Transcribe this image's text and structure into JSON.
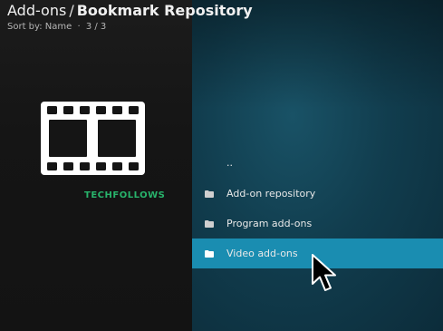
{
  "header": {
    "breadcrumb_parent": "Add-ons",
    "separator": "/",
    "breadcrumb_current": "Bookmark Repository",
    "sort_label": "Sort by: Name",
    "dot": "·",
    "page_count": "3 / 3"
  },
  "watermark": "TECHFOLLOWS",
  "list": {
    "items": [
      {
        "label": "..",
        "icon": "none"
      },
      {
        "label": "Add-on repository",
        "icon": "folder-icon"
      },
      {
        "label": "Program add-ons",
        "icon": "folder-icon"
      },
      {
        "label": "Video add-ons",
        "icon": "folder-icon",
        "selected": true
      }
    ]
  },
  "thumbnail": {
    "icon": "film-strip-icon"
  },
  "colors": {
    "accent": "#1a8db1",
    "panel": "#113d4e",
    "background": "#151515",
    "watermark": "#28b36b"
  }
}
